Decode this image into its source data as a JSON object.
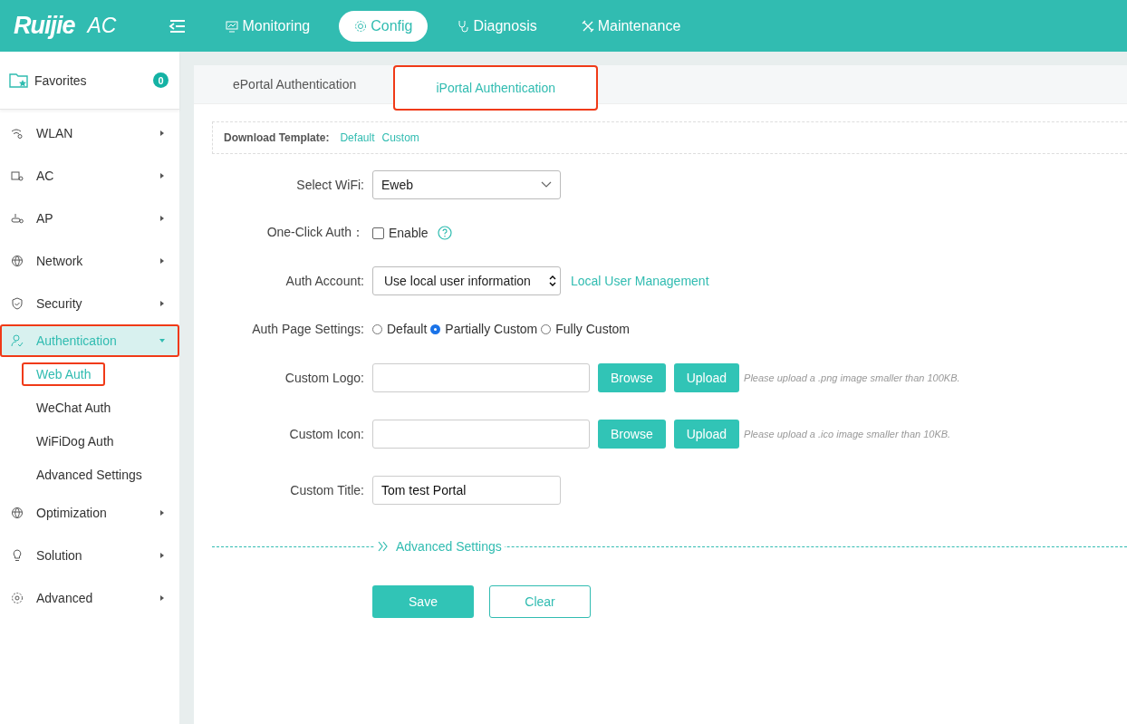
{
  "header": {
    "logo": "Ruijie",
    "product": "AC",
    "nav": [
      {
        "label": "Monitoring",
        "selected": false
      },
      {
        "label": "Config",
        "selected": true
      },
      {
        "label": "Diagnosis",
        "selected": false
      },
      {
        "label": "Maintenance",
        "selected": false
      }
    ]
  },
  "sidebar": {
    "favorites": {
      "label": "Favorites",
      "count": "0"
    },
    "items": [
      {
        "label": "WLAN",
        "expanded": false,
        "selected": false,
        "highlighted": false
      },
      {
        "label": "AC",
        "expanded": false,
        "selected": false,
        "highlighted": false
      },
      {
        "label": "AP",
        "expanded": false,
        "selected": false,
        "highlighted": false
      },
      {
        "label": "Network",
        "expanded": false,
        "selected": false,
        "highlighted": false
      },
      {
        "label": "Security",
        "expanded": false,
        "selected": false,
        "highlighted": false
      },
      {
        "label": "Authentication",
        "expanded": true,
        "selected": true,
        "highlighted": true,
        "children": [
          {
            "label": "Web Auth",
            "selected": true,
            "highlighted": true
          },
          {
            "label": "WeChat Auth",
            "selected": false,
            "highlighted": false
          },
          {
            "label": "WiFiDog Auth",
            "selected": false,
            "highlighted": false
          },
          {
            "label": "Advanced Settings",
            "selected": false,
            "highlighted": false
          }
        ]
      },
      {
        "label": "Optimization",
        "expanded": false,
        "selected": false,
        "highlighted": false
      },
      {
        "label": "Solution",
        "expanded": false,
        "selected": false,
        "highlighted": false
      },
      {
        "label": "Advanced",
        "expanded": false,
        "selected": false,
        "highlighted": false
      }
    ]
  },
  "tabs": [
    {
      "label": "ePortal Authentication",
      "selected": false,
      "highlighted": false
    },
    {
      "label": "iPortal Authentication",
      "selected": true,
      "highlighted": true
    }
  ],
  "template": {
    "label": "Download Template:",
    "links": [
      "Default",
      "Custom"
    ]
  },
  "form": [
    {
      "kind": "select",
      "label": "Select WiFi:",
      "value": "Eweb"
    },
    {
      "kind": "checkbox",
      "label": "One-Click Auth：",
      "option": "Enable",
      "checked": false
    },
    {
      "kind": "select",
      "label": "Auth Account:",
      "value": "Use local user information",
      "link": "Local User Management"
    },
    {
      "kind": "radio",
      "label": "Auth Page Settings:",
      "options": [
        {
          "label": "Default",
          "selected": false
        },
        {
          "label": "Partially Custom",
          "selected": true
        },
        {
          "label": "Fully Custom",
          "selected": false
        }
      ]
    },
    {
      "kind": "file",
      "label": "Custom Logo:",
      "buttons": [
        "Browse",
        "Upload"
      ],
      "hint": "Please upload a .png image smaller than 100KB."
    },
    {
      "kind": "file",
      "label": "Custom Icon:",
      "buttons": [
        "Browse",
        "Upload"
      ],
      "hint": "Please upload a .ico image smaller than 10KB."
    },
    {
      "kind": "text",
      "label": "Custom Title:",
      "value": "Tom test Portal"
    }
  ],
  "advanced": "Advanced Settings",
  "actions": [
    {
      "label": "Save",
      "kind": "primary"
    },
    {
      "label": "Clear",
      "kind": "secondary"
    }
  ]
}
